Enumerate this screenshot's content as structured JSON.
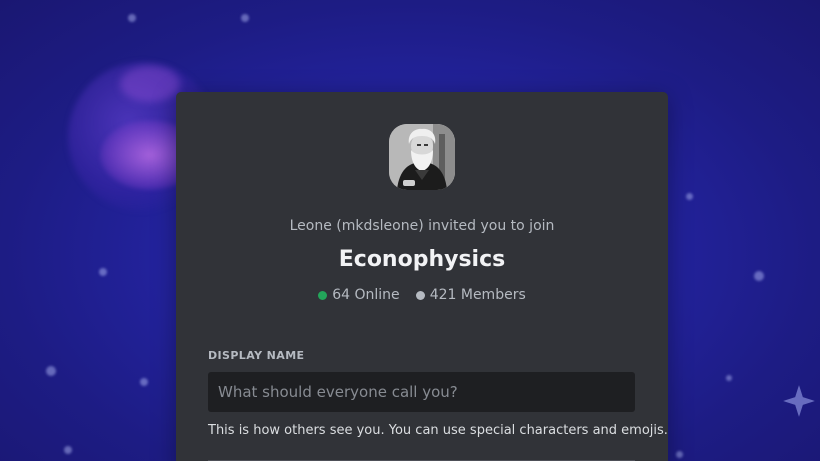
{
  "background": {
    "accent": "#2424a3"
  },
  "invite": {
    "inviter_text": "Leone (mkdsleone) invited you to join",
    "server_name": "Econophysics",
    "online_count": "64 Online",
    "member_count": "421 Members",
    "online_color": "#23a55a"
  },
  "form": {
    "display_name_label": "DISPLAY NAME",
    "display_name_placeholder": "What should everyone call you?",
    "display_name_value": "",
    "help_text": "This is how others see you. You can use special characters and emojis."
  },
  "icons": {
    "server_icon": "server-avatar-portrait"
  }
}
